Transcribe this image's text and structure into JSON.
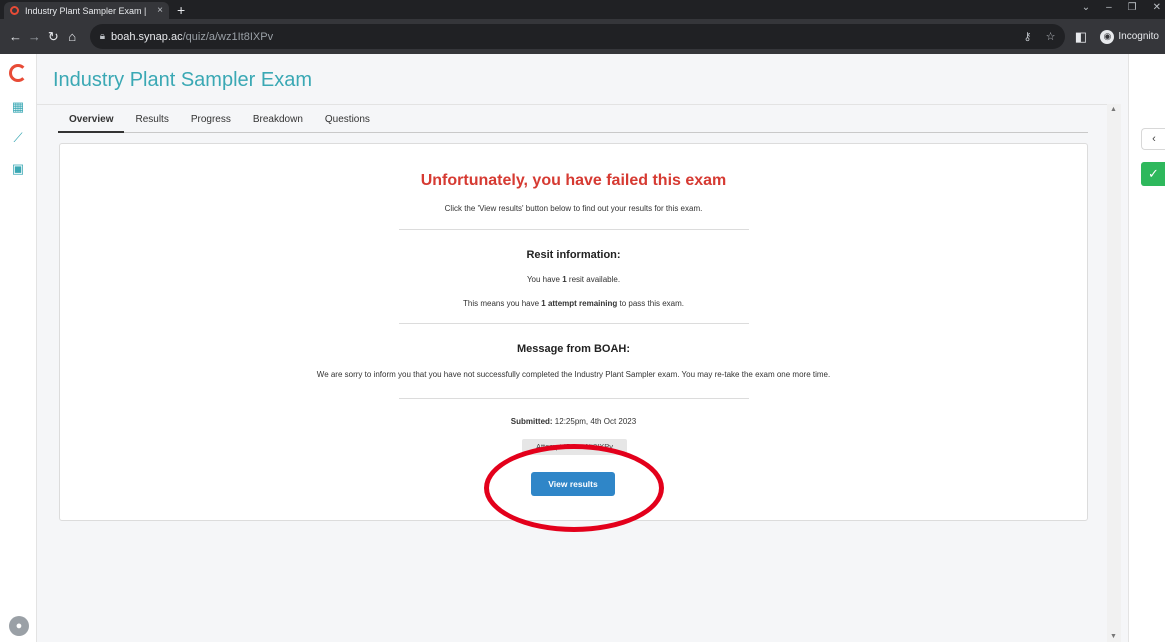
{
  "browser": {
    "tab_title": "Industry Plant Sampler Exam |",
    "tab_close": "×",
    "new_tab": "+",
    "url_host": "boah.synap.ac",
    "url_path": "/quiz/a/wz1It8IXPv",
    "incognito_label": "Incognito"
  },
  "page": {
    "title": "Industry Plant Sampler Exam",
    "tabs": [
      {
        "label": "Overview",
        "active": true
      },
      {
        "label": "Results"
      },
      {
        "label": "Progress"
      },
      {
        "label": "Breakdown"
      },
      {
        "label": "Questions"
      }
    ]
  },
  "result": {
    "heading": "Unfortunately, you have failed this exam",
    "instruction": "Click the 'View results' button below to find out your results for this exam.",
    "resit_heading": "Resit information:",
    "resit_pre": "You have ",
    "resit_count": "1",
    "resit_post": " resit available.",
    "attempt_pre": "This means you have ",
    "attempt_bold": "1 attempt remaining",
    "attempt_post": " to pass this exam.",
    "message_heading": "Message from BOAH:",
    "message_text": "We are sorry to inform you that you have not successfully completed the Industry Plant Sampler exam.  You may re-take the exam one more time.",
    "submitted_label": "Submitted:",
    "submitted_value": " 12:25pm, 4th Oct 2023",
    "attempt_id": "Attempt ID: wz1It8IXPv",
    "view_results_label": "View results"
  },
  "colors": {
    "brand": "#3aa8b4",
    "fail": "#d63a32",
    "primary_button": "#2f86c8",
    "annotation": "#e3001b"
  }
}
